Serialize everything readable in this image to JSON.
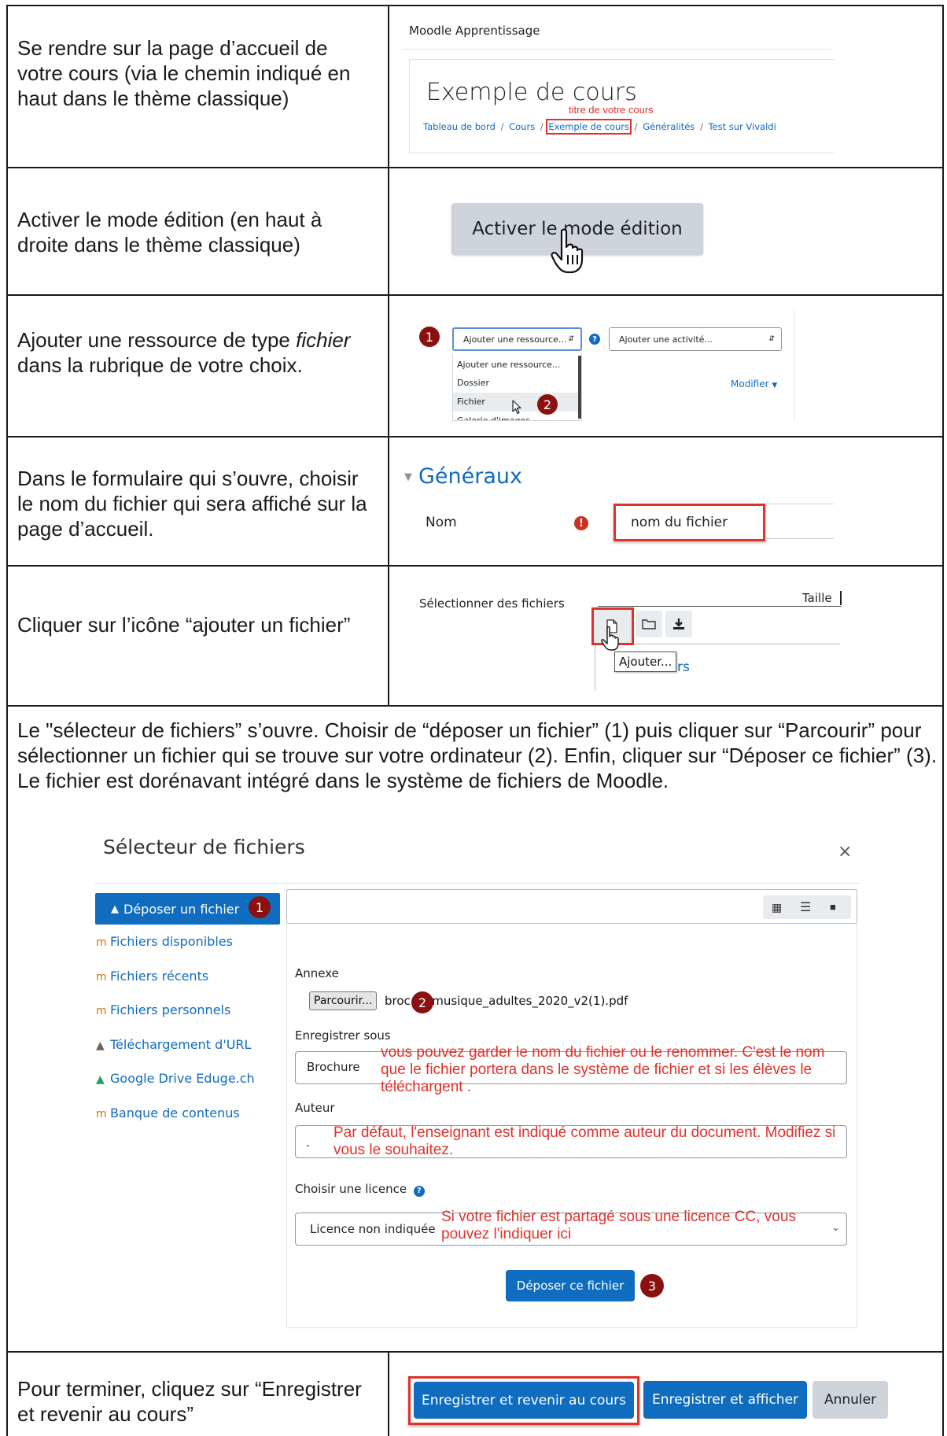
{
  "steps": {
    "s1": "Se rendre sur la page d’accueil de votre cours (via le chemin indiqué en haut dans le thème classique)",
    "s2": "Activer le mode édition (en haut à droite dans le thème classique)",
    "s3_before": "Ajouter une ressource de type ",
    "s3_em": "fichier",
    "s3_after": " dans la rubrique de votre choix.",
    "s4": "Dans le formulaire qui s’ouvre, choisir le nom du fichier qui sera affiché sur la page d’accueil.",
    "s5": "Cliquer sur l’icône “ajouter un fichier”",
    "s6": "Le \"sélecteur de fichiers” s’ouvre. Choisir de “déposer un fichier” (1) puis cliquer sur “Parcourir” pour sélectionner un fichier qui se trouve sur votre ordinateur (2). Enfin, cliquer sur “Déposer ce fichier” (3). Le fichier est dorénavant intégré dans le système de fichiers de Moodle.",
    "s7": "Pour terminer, cliquez sur “Enregistrer et revenir au cours”"
  },
  "shot1": {
    "site_name": "Moodle Apprentissage",
    "course_title": "Exemple de cours",
    "annotation": "titre de votre cours",
    "breadcrumb": [
      "Tableau de bord",
      "Cours",
      "Exemple de cours",
      "Généralités",
      "Test sur Vivaldi"
    ],
    "separator": "/"
  },
  "shot2": {
    "edit_button": "Activer le mode édition"
  },
  "shot3": {
    "badge1": "1",
    "badge2": "2",
    "resource_select": "Ajouter une ressource...",
    "activity_select": "Ajouter une activité...",
    "options": [
      "Ajouter une ressource...",
      "Dossier",
      "Fichier",
      "Galerie d'images"
    ],
    "modify": "Modifier"
  },
  "shot4": {
    "section": "Généraux",
    "name_label": "Nom",
    "name_value": "nom du fichier"
  },
  "shot5": {
    "label": "Sélectionner des fichiers",
    "size_label": "Taille",
    "tooltip": "Ajouter...",
    "partial_text": "rs"
  },
  "picker": {
    "title": "Sélecteur de fichiers",
    "close": "×",
    "sidebar": [
      "Déposer un fichier",
      "Fichiers disponibles",
      "Fichiers récents",
      "Fichiers personnels",
      "Téléchargement d'URL",
      "Google Drive Eduge.ch",
      "Banque de contenus"
    ],
    "badge1": "1",
    "badge2": "2",
    "badge3": "3",
    "annexe_label": "Annexe",
    "browse": "Parcourir...",
    "file_prefix": "broc",
    "file_suffix": "_musique_adultes_2020_v2(1).pdf",
    "save_as_label": "Enregistrer sous",
    "save_as_value": "Brochure",
    "save_as_note": "vous pouvez garder le nom du fichier ou le renommer. C'est le nom que le fichier portera dans le système de fichier et si les élèves le téléchargent .",
    "author_label": "Auteur",
    "author_value": ".",
    "author_note": "Par défaut, l'enseignant est indiqué comme auteur du document. Modifiez si vous le souhaitez.",
    "license_label": "Choisir une licence",
    "license_value": "Licence non indiquée",
    "license_note": "Si votre fichier est partagé sous une licence CC, vous pouvez l'indiquer ici",
    "upload_button": "Déposer ce fichier"
  },
  "final": {
    "save_return": "Enregistrer et revenir au cours",
    "save_show": "Enregistrer et afficher",
    "cancel": "Annuler"
  },
  "colors": {
    "moodle_blue": "#0f6cbf",
    "annotation_red": "#e0312b",
    "badge": "#8b1111"
  }
}
